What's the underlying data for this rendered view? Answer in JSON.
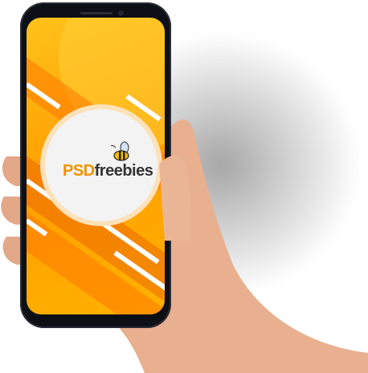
{
  "logo": {
    "prefix": "PSD",
    "suffix": "freebies",
    "full_text": "PSDfreebies"
  },
  "colors": {
    "accent": "#f29100",
    "screen_orange": "#ff9d00",
    "skin": "#e8b08f"
  }
}
